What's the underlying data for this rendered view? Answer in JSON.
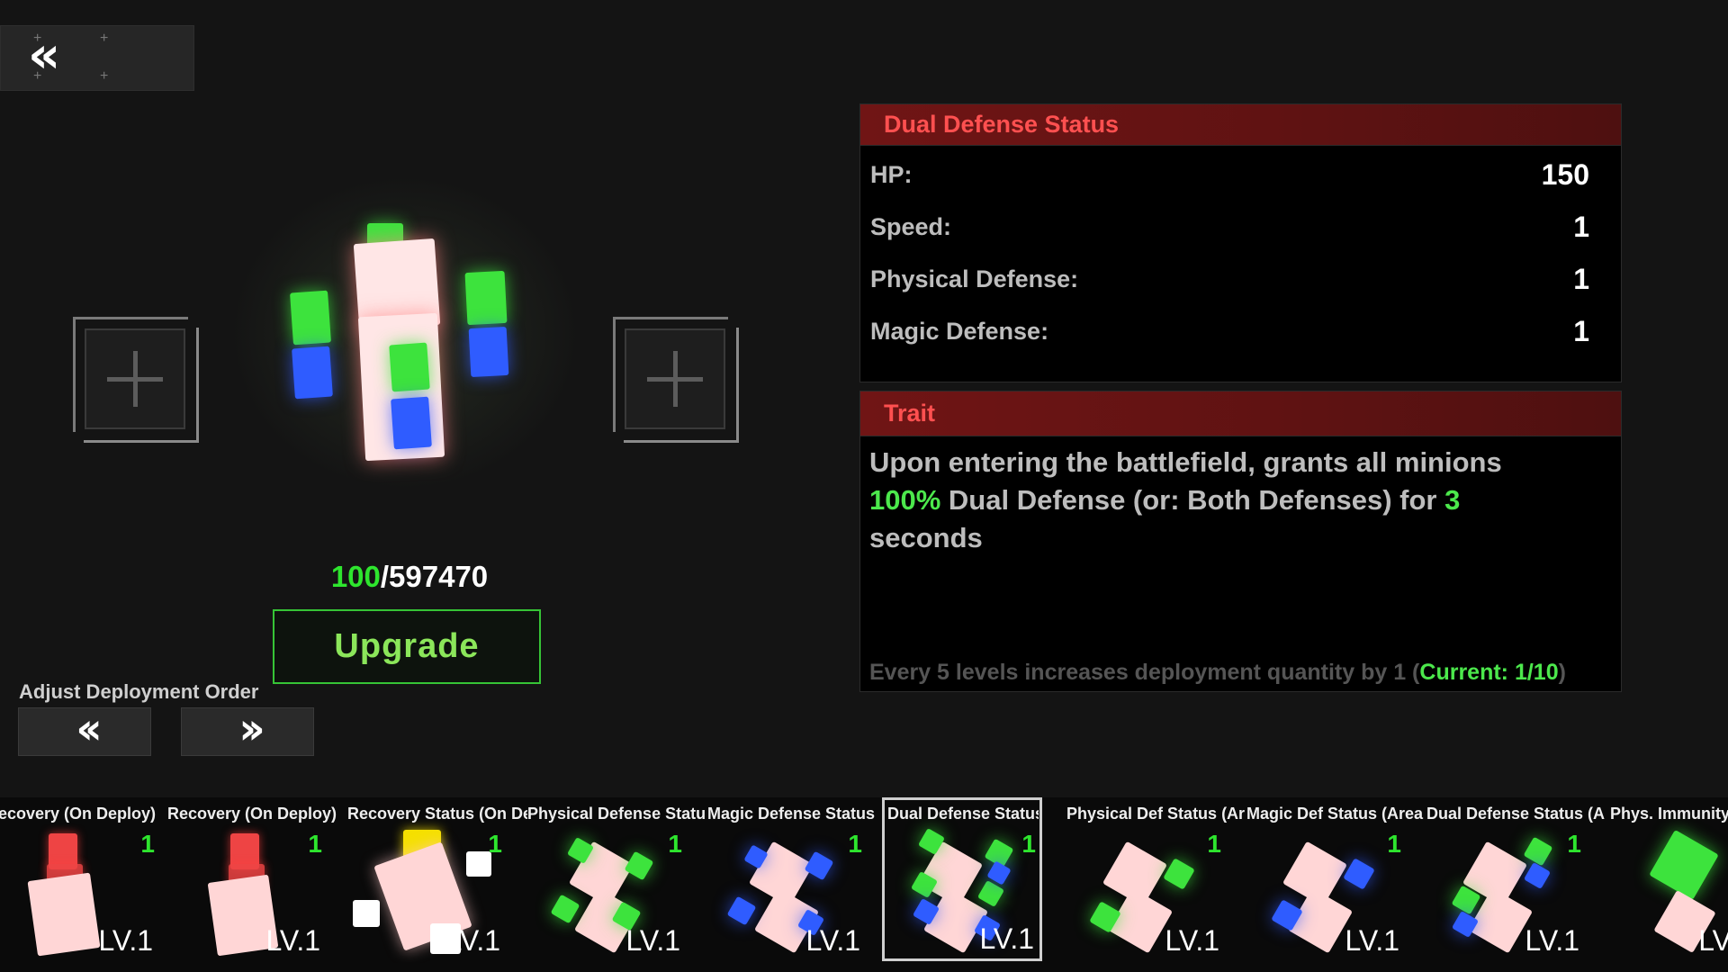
{
  "back_button": {
    "icon": "double-chevron-left-icon",
    "glyph": "‹‹"
  },
  "unit": {
    "counter_current": "100",
    "counter_total": "/597470",
    "upgrade_label": "Upgrade"
  },
  "deployment": {
    "label": "Adjust Deployment Order",
    "left_glyph": "‹‹",
    "right_glyph": "››"
  },
  "stats_panel": {
    "title": "Dual Defense Status",
    "rows": [
      {
        "label": "HP:",
        "value": "150"
      },
      {
        "label": "Speed:",
        "value": "1"
      },
      {
        "label": "Physical Defense:",
        "value": "1"
      },
      {
        "label": "Magic Defense:",
        "value": "1"
      }
    ]
  },
  "trait_panel": {
    "title": "Trait",
    "line1": "Upon entering the battlefield, grants all minions",
    "pct": "100%",
    "line2_mid": " Dual Defense (or: Both Defenses) for ",
    "duration": "3",
    "line3": "seconds",
    "footer_text": "Every 5 levels increases deployment quantity by 1 (",
    "footer_current": "Current: 1/10",
    "footer_close": ")"
  },
  "roster": [
    {
      "name": "ecovery (On Deploy)",
      "count": "1",
      "level": "LV.1"
    },
    {
      "name": "Recovery (On Deploy)",
      "count": "1",
      "level": "LV.1"
    },
    {
      "name": "Recovery Status (On De",
      "count": "1",
      "level": "LV.1"
    },
    {
      "name": "Physical Defense Statu",
      "count": "1",
      "level": "LV.1"
    },
    {
      "name": "Magic Defense Status",
      "count": "1",
      "level": "LV.1"
    },
    {
      "name": "Dual Defense Status",
      "count": "1",
      "level": "LV.1"
    },
    {
      "name": "Physical Def Status (Ar",
      "count": "1",
      "level": "LV.1"
    },
    {
      "name": "Magic Def Status (Area",
      "count": "1",
      "level": "LV.1"
    },
    {
      "name": "Dual Defense Status (A",
      "count": "1",
      "level": "LV.1"
    },
    {
      "name": "Phys. Immunity",
      "count": "",
      "level": "LV"
    }
  ],
  "colors": {
    "accent_green": "#2ee52e",
    "header_red": "#701515",
    "title_red": "#ff5050"
  }
}
